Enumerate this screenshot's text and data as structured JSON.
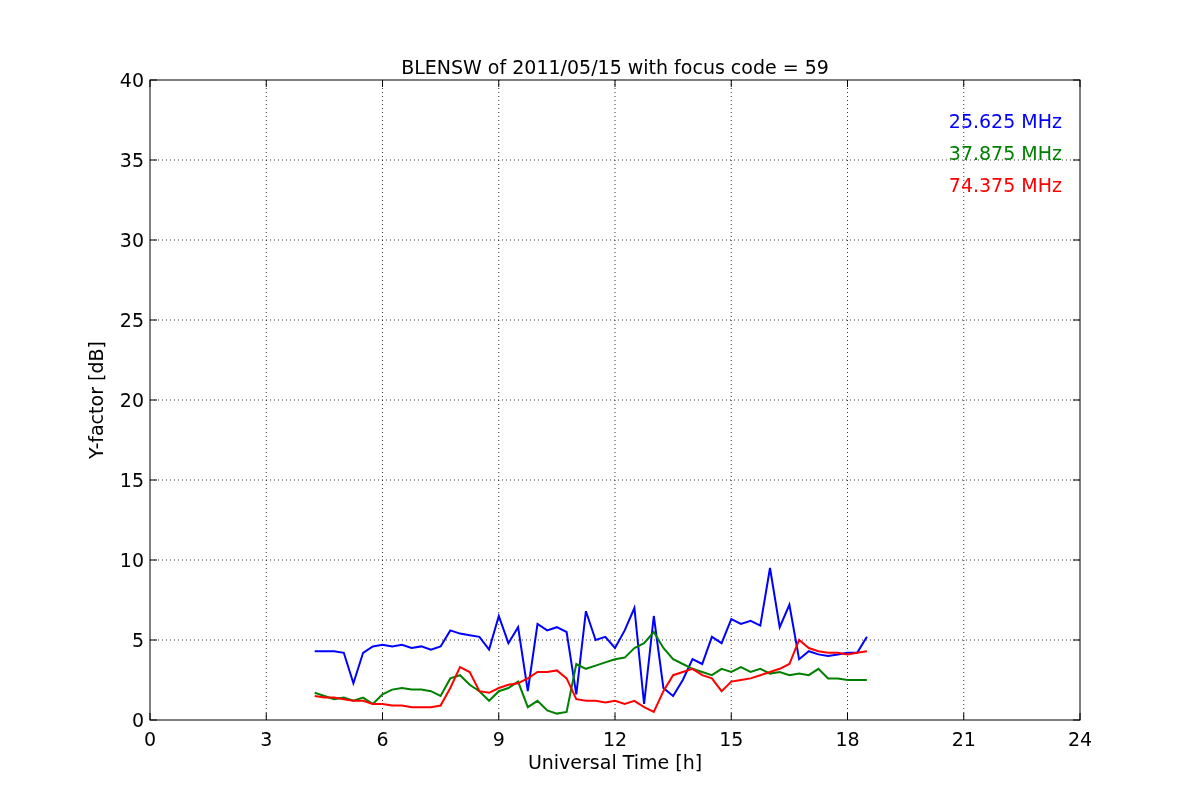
{
  "figure": {
    "chart_data": {
      "type": "line",
      "title": "BLENSW of 2011/05/15 with focus code = 59",
      "xlabel": "Universal Time [h]",
      "ylabel": "Y-factor [dB]",
      "xlim": [
        0,
        24
      ],
      "ylim": [
        0,
        40
      ],
      "xticks": [
        0,
        3,
        6,
        9,
        12,
        15,
        18,
        21,
        24
      ],
      "yticks": [
        0,
        5,
        10,
        15,
        20,
        25,
        30,
        35,
        40
      ],
      "grid": true,
      "x": [
        4.25,
        4.5,
        4.75,
        5.0,
        5.25,
        5.5,
        5.75,
        6.0,
        6.25,
        6.5,
        6.75,
        7.0,
        7.25,
        7.5,
        7.75,
        8.0,
        8.25,
        8.5,
        8.75,
        9.0,
        9.25,
        9.5,
        9.75,
        10.0,
        10.25,
        10.5,
        10.75,
        11.0,
        11.25,
        11.5,
        11.75,
        12.0,
        12.25,
        12.5,
        12.75,
        13.0,
        13.25,
        13.5,
        13.75,
        14.0,
        14.25,
        14.5,
        14.75,
        15.0,
        15.25,
        15.5,
        15.75,
        16.0,
        16.25,
        16.5,
        16.75,
        17.0,
        17.25,
        17.5,
        17.75,
        18.0,
        18.25,
        18.5
      ],
      "series": [
        {
          "name": "25.625 MHz",
          "color": "#0000ff",
          "values": [
            4.3,
            4.3,
            4.3,
            4.2,
            2.3,
            4.2,
            4.6,
            4.7,
            4.6,
            4.7,
            4.5,
            4.6,
            4.4,
            4.6,
            5.6,
            5.4,
            5.3,
            5.2,
            4.4,
            6.5,
            4.8,
            5.8,
            1.8,
            6.0,
            5.6,
            5.8,
            5.5,
            1.6,
            6.8,
            5.0,
            5.2,
            4.5,
            5.6,
            7.0,
            1.0,
            6.5,
            2.0,
            1.5,
            2.5,
            3.8,
            3.5,
            5.2,
            4.8,
            6.3,
            6.0,
            6.2,
            5.9,
            9.5,
            5.8,
            7.2,
            3.8,
            4.3,
            4.1,
            4.0,
            4.1,
            4.2,
            4.2,
            5.2
          ]
        },
        {
          "name": "37.875 MHz",
          "color": "#008000",
          "values": [
            1.7,
            1.5,
            1.3,
            1.4,
            1.2,
            1.4,
            1.0,
            1.6,
            1.9,
            2.0,
            1.9,
            1.9,
            1.8,
            1.5,
            2.6,
            2.8,
            2.2,
            1.8,
            1.2,
            1.8,
            2.0,
            2.4,
            0.8,
            1.2,
            0.6,
            0.4,
            0.5,
            3.5,
            3.2,
            3.4,
            3.6,
            3.8,
            3.9,
            4.5,
            4.8,
            5.5,
            4.5,
            3.8,
            3.5,
            3.2,
            3.0,
            2.8,
            3.2,
            3.0,
            3.3,
            3.0,
            3.2,
            2.9,
            3.0,
            2.8,
            2.9,
            2.8,
            3.2,
            2.6,
            2.6,
            2.5,
            2.5,
            2.5
          ]
        },
        {
          "name": "74.375 MHz",
          "color": "#ff0000",
          "values": [
            1.5,
            1.4,
            1.4,
            1.3,
            1.2,
            1.2,
            1.0,
            1.0,
            0.9,
            0.9,
            0.8,
            0.8,
            0.8,
            0.9,
            2.0,
            3.3,
            3.0,
            1.8,
            1.7,
            2.0,
            2.2,
            2.3,
            2.6,
            3.0,
            3.0,
            3.1,
            2.6,
            1.3,
            1.2,
            1.2,
            1.1,
            1.2,
            1.0,
            1.2,
            0.8,
            0.5,
            1.8,
            2.8,
            3.0,
            3.2,
            2.8,
            2.6,
            1.8,
            2.4,
            2.5,
            2.6,
            2.8,
            3.0,
            3.2,
            3.5,
            5.0,
            4.5,
            4.3,
            4.2,
            4.2,
            4.1,
            4.2,
            4.3
          ]
        }
      ]
    }
  }
}
